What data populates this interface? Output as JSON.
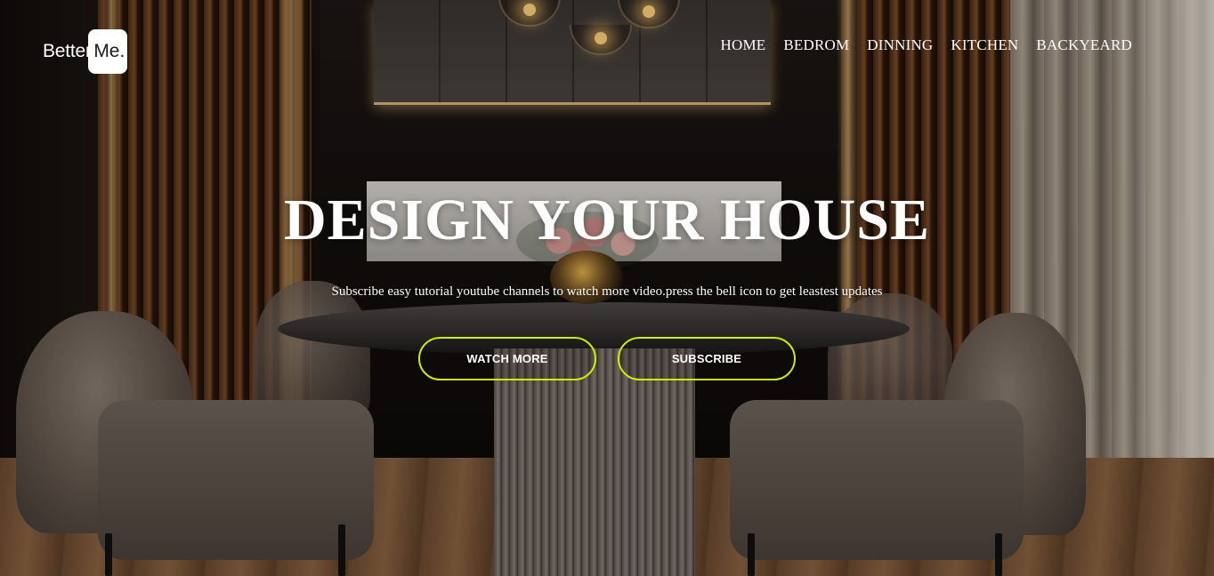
{
  "brand": {
    "text": "Better",
    "badge": "Me."
  },
  "nav": {
    "items": [
      "HOME",
      "BEDROM",
      "DINNING",
      "KITCHEN",
      "BACKYEARD"
    ]
  },
  "hero": {
    "title": "DESIGN YOUR HOUSE",
    "subtitle": "Subscribe easy tutorial youtube channels to watch more video.press the bell icon to get leastest updates",
    "buttons": {
      "watch_more": "WATCH MORE",
      "subscribe": "SUBSCRIBE"
    }
  },
  "colors": {
    "button_border": "#c8f000",
    "text": "#ffffff"
  }
}
